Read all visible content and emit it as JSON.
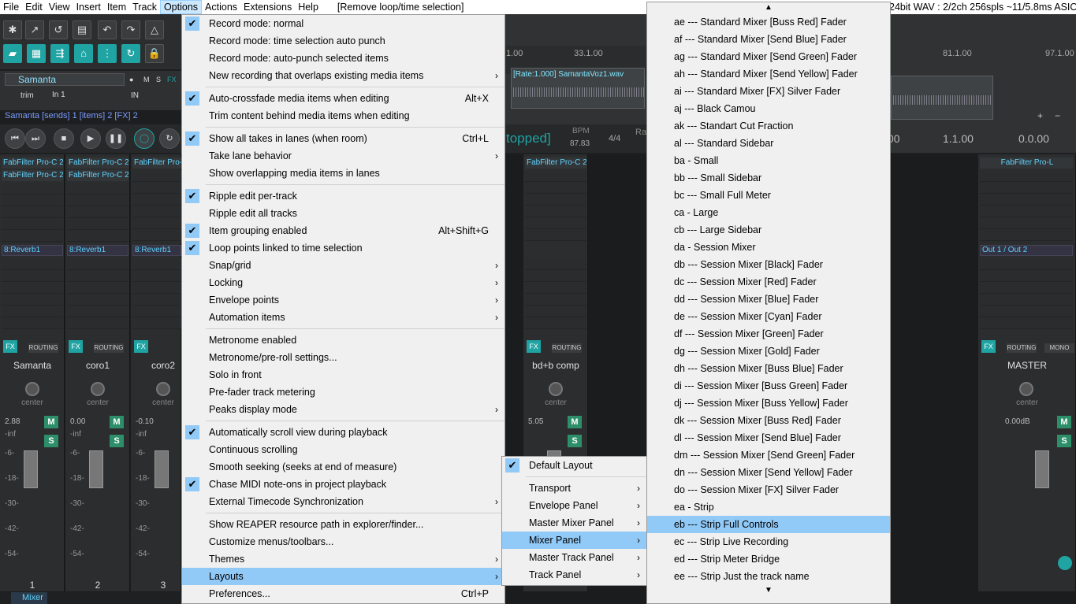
{
  "menubar": {
    "items": [
      "File",
      "Edit",
      "View",
      "Insert",
      "Item",
      "Track",
      "Options",
      "Actions",
      "Extensions",
      "Help"
    ],
    "active": "Options",
    "hint": "[Remove loop/time selection]",
    "status": "24bit WAV : 2/2ch 256spls ~11/5.8ms ASIO)"
  },
  "track": {
    "name": "Samanta",
    "in": "In 1",
    "trim": "trim",
    "info": "Samanta [sends] 1 [items] 2 [FX] 2"
  },
  "timeline": {
    "ruler": [
      "1.00",
      "33.1.00"
    ],
    "item_label": "[Rate:1.000] SamantaVoz1.wav",
    "status": "topped]",
    "bpm_label": "BPM",
    "bpm": "87.83",
    "sig": "4/4",
    "ra": "Ra"
  },
  "right": {
    "ruler": [
      "81.1.00",
      "97.1.00"
    ],
    "time1": "1.1.00",
    "time2": "0.0.00",
    "time0": "00"
  },
  "mixer": {
    "strips": [
      {
        "name": "Samanta",
        "fx": [
          "FabFilter Pro-C 2",
          "FabFilter Pro-C 2"
        ],
        "send": "8:Reverb1",
        "vol": "2.88",
        "num": "1"
      },
      {
        "name": "coro1",
        "fx": [
          "FabFilter Pro-C 2",
          "FabFilter Pro-C 2"
        ],
        "send": "8:Reverb1",
        "vol": "0.00",
        "num": "2"
      },
      {
        "name": "coro2",
        "fx": [
          "FabFilter Pro-C",
          ""
        ],
        "send": "8:Reverb1",
        "vol": "-0.10",
        "num": "3"
      },
      {
        "name": "bd+b comp",
        "fx": [
          "FabFilter Pro-C 2",
          ""
        ],
        "send": "",
        "vol": "5.05",
        "num": ""
      }
    ],
    "master": {
      "name": "MASTER",
      "fx": "FabFilter Pro-L",
      "out": "Out 1 / Out 2",
      "vol": "0.00dB",
      "mono": "MONO"
    },
    "labels": {
      "center": "center",
      "fx": "FX",
      "routing": "ROUTING",
      "m": "M",
      "s": "S",
      "trim": "trim",
      "in": "IN",
      "inf": "-inf"
    },
    "scale": [
      "-6-",
      "-18-",
      "-30-",
      "-42-",
      "-54-"
    ],
    "tab": "Mixer"
  },
  "options_menu": [
    {
      "label": "Record mode: normal",
      "checked": true
    },
    {
      "label": "Record mode: time selection auto punch"
    },
    {
      "label": "Record mode: auto-punch selected items"
    },
    {
      "label": "New recording that overlaps existing media items",
      "sub": true
    },
    {
      "sep": true
    },
    {
      "label": "Auto-crossfade media items when editing",
      "checked": true,
      "shortcut": "Alt+X"
    },
    {
      "label": "Trim content behind media items when editing"
    },
    {
      "sep": true
    },
    {
      "label": "Show all takes in lanes (when room)",
      "checked": true,
      "shortcut": "Ctrl+L"
    },
    {
      "label": "Take lane behavior",
      "sub": true
    },
    {
      "label": "Show overlapping media items in lanes"
    },
    {
      "sep": true
    },
    {
      "label": "Ripple edit per-track",
      "checked": true
    },
    {
      "label": "Ripple edit all tracks"
    },
    {
      "label": "Item grouping enabled",
      "checked": true,
      "shortcut": "Alt+Shift+G"
    },
    {
      "label": "Loop points linked to time selection",
      "checked": true
    },
    {
      "label": "Snap/grid",
      "sub": true
    },
    {
      "label": "Locking",
      "sub": true
    },
    {
      "label": "Envelope points",
      "sub": true
    },
    {
      "label": "Automation items",
      "sub": true
    },
    {
      "sep": true
    },
    {
      "label": "Metronome enabled"
    },
    {
      "label": "Metronome/pre-roll settings..."
    },
    {
      "label": "Solo in front"
    },
    {
      "label": "Pre-fader track metering"
    },
    {
      "label": "Peaks display mode",
      "sub": true
    },
    {
      "sep": true
    },
    {
      "label": "Automatically scroll view during playback",
      "checked": true
    },
    {
      "label": "Continuous scrolling"
    },
    {
      "label": "Smooth seeking (seeks at end of measure)"
    },
    {
      "label": "Chase MIDI note-ons in project playback",
      "checked": true
    },
    {
      "label": "External Timecode Synchronization",
      "sub": true
    },
    {
      "sep": true
    },
    {
      "label": "Show REAPER resource path in explorer/finder..."
    },
    {
      "label": "Customize menus/toolbars..."
    },
    {
      "label": "Themes",
      "sub": true
    },
    {
      "label": "Layouts",
      "sub": true,
      "highlight": true
    },
    {
      "label": "Preferences...",
      "shortcut": "Ctrl+P"
    }
  ],
  "layouts_menu": [
    {
      "label": "Default Layout",
      "checked": true
    },
    {
      "sep": true
    },
    {
      "label": "Transport",
      "sub": true
    },
    {
      "label": "Envelope Panel",
      "sub": true
    },
    {
      "label": "Master Mixer Panel",
      "sub": true
    },
    {
      "label": "Mixer Panel",
      "sub": true,
      "highlight": true
    },
    {
      "label": "Master Track Panel",
      "sub": true
    },
    {
      "label": "Track Panel",
      "sub": true
    }
  ],
  "mixer_panel_menu": [
    "ae --- Standard Mixer [Buss Red] Fader",
    "af --- Standard Mixer [Send Blue] Fader",
    "ag --- Standard Mixer [Send Green] Fader",
    "ah --- Standard Mixer [Send Yellow] Fader",
    "ai --- Standard Mixer [FX] Silver Fader",
    "aj --- Black Camou",
    "ak --- Standart Cut Fraction",
    "al --- Standard Sidebar",
    "ba - Small",
    "bb --- Small Sidebar",
    "bc --- Small Full Meter",
    "ca - Large",
    "cb --- Large Sidebar",
    "da - Session Mixer",
    "db --- Session Mixer [Black] Fader",
    "dc --- Session Mixer [Red] Fader",
    "dd --- Session Mixer [Blue] Fader",
    "de --- Session Mixer [Cyan] Fader",
    "df --- Session Mixer [Green] Fader",
    "dg --- Session Mixer [Gold] Fader",
    "dh --- Session Mixer [Buss Blue] Fader",
    "di --- Session Mixer [Buss Green] Fader",
    "dj --- Session Mixer [Buss Yellow] Fader",
    "dk --- Session Mixer [Buss Red] Fader",
    "dl --- Session Mixer [Send Blue] Fader",
    "dm --- Session Mixer [Send Green] Fader",
    "dn --- Session Mixer [Send Yellow] Fader",
    "do --- Session Mixer [FX] Silver Fader",
    "ea - Strip",
    "eb --- Strip Full Controls",
    "ec --- Strip Live Recording",
    "ed --- Strip Meter Bridge",
    "ee --- Strip Just the track name"
  ],
  "mixer_panel_highlight": "eb --- Strip Full Controls",
  "colors": {
    "accent": "#1fa3a3",
    "highlight": "#91c9f7"
  }
}
